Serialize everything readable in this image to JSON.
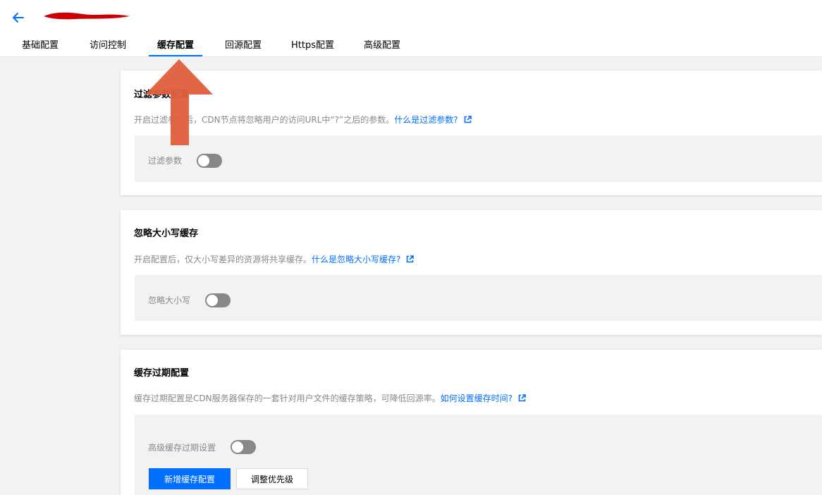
{
  "colors": {
    "accent": "#006eff",
    "toggle_off": "#888888",
    "annotation_arrow": "#e0603e",
    "redaction": "#cc0000"
  },
  "header": {
    "back_icon": "arrow-left-icon"
  },
  "tabs": [
    {
      "label": "基础配置",
      "active": false
    },
    {
      "label": "访问控制",
      "active": false
    },
    {
      "label": "缓存配置",
      "active": true
    },
    {
      "label": "回源配置",
      "active": false
    },
    {
      "label": "Https配置",
      "active": false
    },
    {
      "label": "高级配置",
      "active": false
    }
  ],
  "filter_params": {
    "title": "过滤参数配置",
    "desc": "开启过滤参数后，CDN节点将忽略用户的访问URL中“?”之后的参数。",
    "link": "什么是过滤参数?",
    "link_icon": "external-link-icon",
    "toggle_label": "过滤参数",
    "toggle_on": false
  },
  "ignore_case": {
    "title": "忽略大小写缓存",
    "desc": "开启配置后，仅大小写差异的资源将共享缓存。",
    "link": "什么是忽略大小写缓存?",
    "link_icon": "external-link-icon",
    "toggle_label": "忽略大小写",
    "toggle_on": false
  },
  "cache_expire": {
    "title": "缓存过期配置",
    "desc": "缓存过期配置是CDN服务器保存的一套针对用户文件的缓存策略，可降低回源率。",
    "link": "如何设置缓存时间?",
    "link_icon": "external-link-icon",
    "toggle_label": "高级缓存过期设置",
    "toggle_on": false,
    "add_button": "新增缓存配置",
    "priority_button": "调整优先级"
  }
}
